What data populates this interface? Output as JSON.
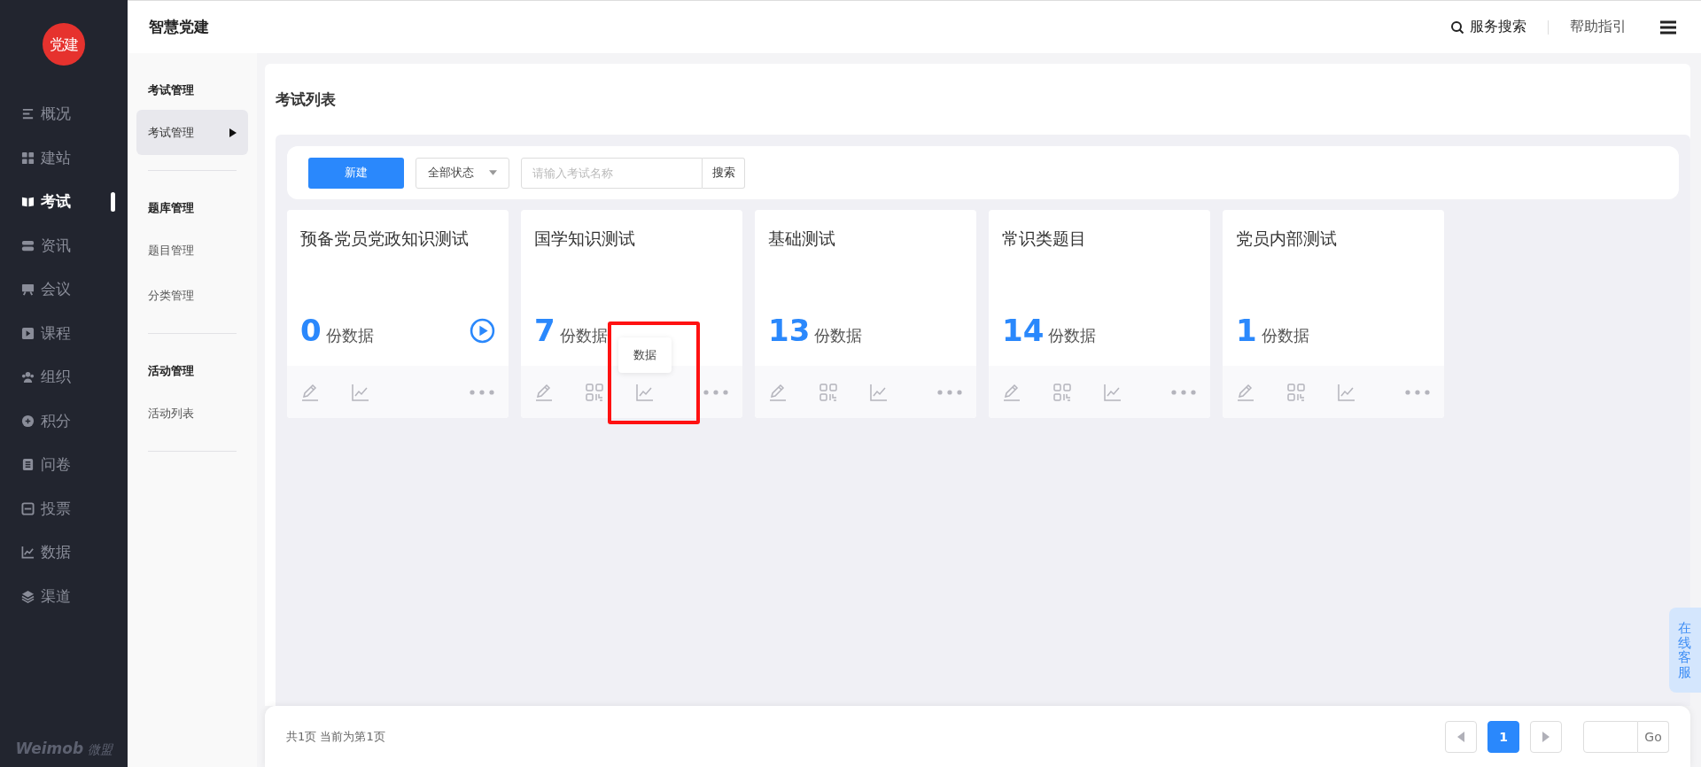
{
  "logo_text": "党建",
  "nav": [
    {
      "label": "概况",
      "selected": false
    },
    {
      "label": "建站",
      "selected": false
    },
    {
      "label": "考试",
      "selected": true
    },
    {
      "label": "资讯",
      "selected": false
    },
    {
      "label": "会议",
      "selected": false
    },
    {
      "label": "课程",
      "selected": false
    },
    {
      "label": "组织",
      "selected": false
    },
    {
      "label": "积分",
      "selected": false
    },
    {
      "label": "问卷",
      "selected": false
    },
    {
      "label": "投票",
      "selected": false
    },
    {
      "label": "数据",
      "selected": false
    },
    {
      "label": "渠道",
      "selected": false
    }
  ],
  "footer_logo": {
    "latin": "Weimob",
    "cjk": "微盟"
  },
  "app_title": "智慧党建",
  "header_actions": {
    "search": "服务搜索",
    "help": "帮助指引"
  },
  "subnav": [
    {
      "title": "考试管理",
      "items": [
        {
          "label": "考试管理",
          "selected": true
        }
      ]
    },
    {
      "title": "题库管理",
      "items": [
        {
          "label": "题目管理",
          "selected": false
        },
        {
          "label": "分类管理",
          "selected": false
        }
      ]
    },
    {
      "title": "活动管理",
      "items": [
        {
          "label": "活动列表",
          "selected": false
        }
      ]
    }
  ],
  "page_title": "考试列表",
  "toolbar": {
    "new_button": "新建",
    "status_filter": "全部状态",
    "search_placeholder": "请输入考试名称",
    "search_button": "搜索"
  },
  "cards": [
    {
      "title": "预备党员党政知识测试",
      "count": "0",
      "unit": "份数据",
      "playable": true,
      "actions": [
        {
          "kind": "edit"
        },
        {
          "kind": "chart"
        },
        {
          "kind": "more"
        }
      ]
    },
    {
      "title": "国学知识测试",
      "count": "7",
      "unit": "份数据",
      "playable": false,
      "actions": [
        {
          "kind": "edit"
        },
        {
          "kind": "qr"
        },
        {
          "kind": "chart",
          "tooltip": "数据",
          "highlighted": true
        },
        {
          "kind": "more"
        }
      ]
    },
    {
      "title": "基础测试",
      "count": "13",
      "unit": "份数据",
      "playable": false,
      "actions": [
        {
          "kind": "edit"
        },
        {
          "kind": "qr"
        },
        {
          "kind": "chart"
        },
        {
          "kind": "more"
        }
      ]
    },
    {
      "title": "常识类题目",
      "count": "14",
      "unit": "份数据",
      "playable": false,
      "actions": [
        {
          "kind": "edit"
        },
        {
          "kind": "qr"
        },
        {
          "kind": "chart"
        },
        {
          "kind": "more"
        }
      ]
    },
    {
      "title": "党员内部测试",
      "count": "1",
      "unit": "份数据",
      "playable": false,
      "actions": [
        {
          "kind": "edit"
        },
        {
          "kind": "qr"
        },
        {
          "kind": "chart"
        },
        {
          "kind": "more"
        }
      ]
    }
  ],
  "pagination": {
    "summary": "共1页 当前为第1页",
    "pages": [
      {
        "label": "1",
        "selected": true
      }
    ],
    "go_button": "Go"
  },
  "support_tab": "在线客服"
}
